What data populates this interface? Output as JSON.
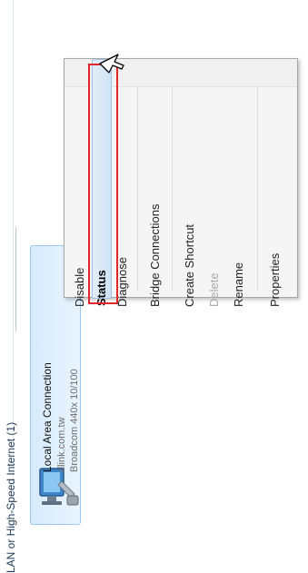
{
  "group": {
    "header": "LAN or High-Speed Internet (1)"
  },
  "connection": {
    "name": "Local Area Connection",
    "network": "dlink.com.tw",
    "adapter": "Broadcom 440x 10/100"
  },
  "menu": {
    "items": [
      {
        "label": "Disable",
        "state": "normal"
      },
      {
        "label": "Status",
        "state": "bold-highlighted"
      },
      {
        "label": "Diagnose",
        "state": "normal"
      },
      {
        "label": "Bridge Connections",
        "state": "normal"
      },
      {
        "label": "Create Shortcut",
        "state": "normal"
      },
      {
        "label": "Delete",
        "state": "disabled"
      },
      {
        "label": "Rename",
        "state": "normal"
      },
      {
        "label": "Properties",
        "state": "normal"
      }
    ]
  },
  "colors": {
    "highlight_box": "#e2262a",
    "tile_bg": "#d7ebfb",
    "header_text": "#1e3956"
  },
  "icons": {
    "connection": "network-adapter-icon",
    "pointer": "mouse-cursor-icon"
  }
}
